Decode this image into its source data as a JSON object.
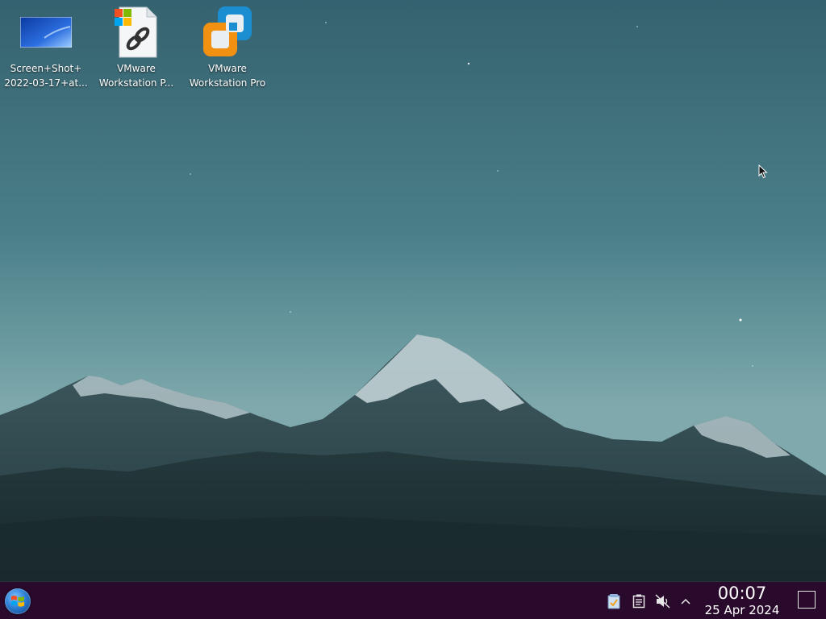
{
  "desktop": {
    "icons": [
      {
        "label_line1": "Screen+Shot+",
        "label_line2": "2022-03-17+at...",
        "icon": "image-file-icon"
      },
      {
        "label_line1": "VMware",
        "label_line2": "Workstation P...",
        "icon": "windows-shortcut-icon"
      },
      {
        "label_line1": "VMware",
        "label_line2": "Workstation Pro",
        "icon": "vmware-icon"
      }
    ]
  },
  "taskbar": {
    "start_icon": "windows-start-icon",
    "tray": [
      {
        "icon": "update-notifier-icon"
      },
      {
        "icon": "clipboard-icon"
      },
      {
        "icon": "volume-muted-icon"
      },
      {
        "icon": "chevron-up-icon"
      }
    ],
    "clock": {
      "time": "00:07",
      "date": "25 Apr 2024"
    },
    "show_desktop_icon": "show-desktop-icon"
  },
  "colors": {
    "taskbar_bg": "#2a0a2c",
    "sky_top": "#35626f",
    "sky_bottom": "#7fa9ad",
    "vmware_blue": "#1a8ed0",
    "vmware_orange": "#f29111"
  }
}
